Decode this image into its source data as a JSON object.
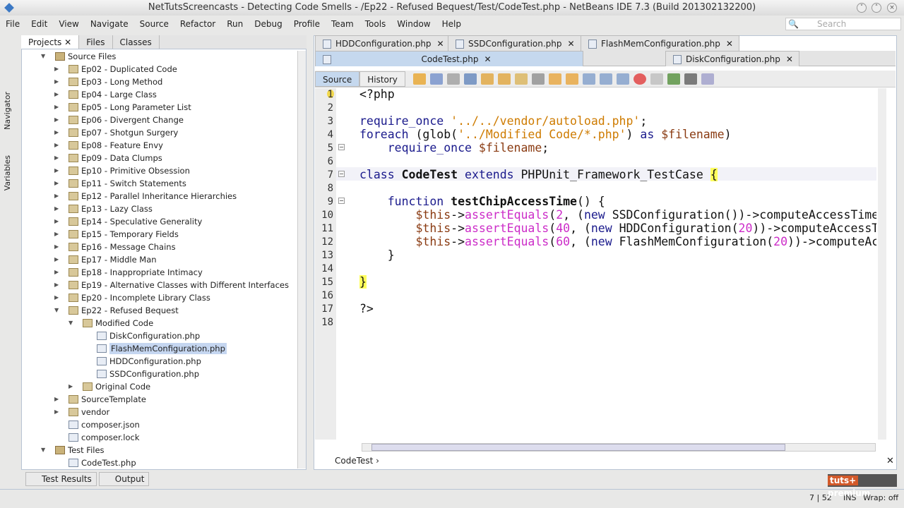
{
  "title": "NetTutsScreencasts - Detecting Code Smells - /Ep22 - Refused Bequest/Test/CodeTest.php - NetBeans IDE 7.3 (Build 201302132200)",
  "menu": [
    "File",
    "Edit",
    "View",
    "Navigate",
    "Source",
    "Refactor",
    "Run",
    "Debug",
    "Profile",
    "Team",
    "Tools",
    "Window",
    "Help"
  ],
  "search_placeholder": "Search",
  "side_strip": [
    "Navigator",
    "Variables"
  ],
  "project_tabs": [
    "Projects",
    "Files",
    "Classes"
  ],
  "tree": [
    {
      "label": "Source Files",
      "level": 1,
      "type": "pkg",
      "state": "open"
    },
    {
      "label": "Ep02 - Duplicated Code",
      "level": 2,
      "type": "folder",
      "state": "closed"
    },
    {
      "label": "Ep03 - Long Method",
      "level": 2,
      "type": "folder",
      "state": "closed"
    },
    {
      "label": "Ep04 - Large Class",
      "level": 2,
      "type": "folder",
      "state": "closed"
    },
    {
      "label": "Ep05 - Long Parameter List",
      "level": 2,
      "type": "folder",
      "state": "closed"
    },
    {
      "label": "Ep06 - Divergent Change",
      "level": 2,
      "type": "folder",
      "state": "closed"
    },
    {
      "label": "Ep07 - Shotgun Surgery",
      "level": 2,
      "type": "folder",
      "state": "closed"
    },
    {
      "label": "Ep08 - Feature Envy",
      "level": 2,
      "type": "folder",
      "state": "closed"
    },
    {
      "label": "Ep09 - Data Clumps",
      "level": 2,
      "type": "folder",
      "state": "closed"
    },
    {
      "label": "Ep10 - Primitive Obsession",
      "level": 2,
      "type": "folder",
      "state": "closed"
    },
    {
      "label": "Ep11 - Switch Statements",
      "level": 2,
      "type": "folder",
      "state": "closed"
    },
    {
      "label": "Ep12 - Parallel Inheritance Hierarchies",
      "level": 2,
      "type": "folder",
      "state": "closed"
    },
    {
      "label": "Ep13 - Lazy Class",
      "level": 2,
      "type": "folder",
      "state": "closed"
    },
    {
      "label": "Ep14 - Speculative Generality",
      "level": 2,
      "type": "folder",
      "state": "closed"
    },
    {
      "label": "Ep15 - Temporary Fields",
      "level": 2,
      "type": "folder",
      "state": "closed"
    },
    {
      "label": "Ep16 - Message Chains",
      "level": 2,
      "type": "folder",
      "state": "closed"
    },
    {
      "label": "Ep17 - Middle Man",
      "level": 2,
      "type": "folder",
      "state": "closed"
    },
    {
      "label": "Ep18 - Inappropriate Intimacy",
      "level": 2,
      "type": "folder",
      "state": "closed"
    },
    {
      "label": "Ep19 - Alternative Classes with Different Interfaces",
      "level": 2,
      "type": "folder",
      "state": "closed"
    },
    {
      "label": "Ep20 - Incomplete Library Class",
      "level": 2,
      "type": "folder",
      "state": "closed"
    },
    {
      "label": "Ep22 - Refused Bequest",
      "level": 2,
      "type": "folder",
      "state": "open"
    },
    {
      "label": "Modified Code",
      "level": 3,
      "type": "folder",
      "state": "open"
    },
    {
      "label": "DiskConfiguration.php",
      "level": 4,
      "type": "file"
    },
    {
      "label": "FlashMemConfiguration.php",
      "level": 4,
      "type": "file",
      "selected": true
    },
    {
      "label": "HDDConfiguration.php",
      "level": 4,
      "type": "file"
    },
    {
      "label": "SSDConfiguration.php",
      "level": 4,
      "type": "file"
    },
    {
      "label": "Original Code",
      "level": 3,
      "type": "folder",
      "state": "closed"
    },
    {
      "label": "SourceTemplate",
      "level": 2,
      "type": "folder",
      "state": "closed"
    },
    {
      "label": "vendor",
      "level": 2,
      "type": "folder",
      "state": "closed"
    },
    {
      "label": "composer.json",
      "level": 2,
      "type": "file"
    },
    {
      "label": "composer.lock",
      "level": 2,
      "type": "file"
    },
    {
      "label": "Test Files",
      "level": 1,
      "type": "pkg",
      "state": "open"
    },
    {
      "label": "CodeTest.php",
      "level": 2,
      "type": "file"
    }
  ],
  "editor_tabs_row1": [
    "HDDConfiguration.php",
    "SSDConfiguration.php",
    "FlashMemConfiguration.php"
  ],
  "editor_tabs_row2": [
    "CodeTest.php",
    "DiskConfiguration.php"
  ],
  "active_tab": "CodeTest.php",
  "source_label": "Source",
  "history_label": "History",
  "code": [
    [
      [
        "<?php",
        ""
      ]
    ],
    [],
    [
      [
        "require_once ",
        "kw"
      ],
      [
        "'../../vendor/autoload.php'",
        "str"
      ],
      [
        ";",
        ""
      ]
    ],
    [
      [
        "foreach ",
        "kw"
      ],
      [
        "(glob(",
        ""
      ],
      [
        "'../Modified Code/*.php'",
        "str"
      ],
      [
        ") ",
        ""
      ],
      [
        "as ",
        "kw"
      ],
      [
        "$filename",
        "var"
      ],
      [
        ")",
        ""
      ]
    ],
    [
      [
        "    require_once ",
        "kw"
      ],
      [
        "$filename",
        "var"
      ],
      [
        ";",
        ""
      ]
    ],
    [],
    [
      [
        "class ",
        "kw"
      ],
      [
        "CodeTest",
        "b"
      ],
      [
        " extends ",
        "kw"
      ],
      [
        "PHPUnit_Framework_TestCase ",
        ""
      ],
      [
        "{",
        "br"
      ]
    ],
    [],
    [
      [
        "    function ",
        "kw"
      ],
      [
        "testChipAccessTime",
        "b"
      ],
      [
        "() {",
        ""
      ]
    ],
    [
      [
        "        ",
        ""
      ],
      [
        "$this",
        "var"
      ],
      [
        "->",
        ""
      ],
      [
        "assertEquals",
        "fn"
      ],
      [
        "(",
        ""
      ],
      [
        "2",
        "num"
      ],
      [
        ", (",
        ""
      ],
      [
        "new ",
        "kw"
      ],
      [
        "SSDConfiguration())->computeAccessTime",
        ""
      ]
    ],
    [
      [
        "        ",
        ""
      ],
      [
        "$this",
        "var"
      ],
      [
        "->",
        ""
      ],
      [
        "assertEquals",
        "fn"
      ],
      [
        "(",
        ""
      ],
      [
        "40",
        "num"
      ],
      [
        ", (",
        ""
      ],
      [
        "new ",
        "kw"
      ],
      [
        "HDDConfiguration(",
        ""
      ],
      [
        "20",
        "num"
      ],
      [
        "))->computeAccessTime",
        ""
      ]
    ],
    [
      [
        "        ",
        ""
      ],
      [
        "$this",
        "var"
      ],
      [
        "->",
        ""
      ],
      [
        "assertEquals",
        "fn"
      ],
      [
        "(",
        ""
      ],
      [
        "60",
        "num"
      ],
      [
        ", (",
        ""
      ],
      [
        "new ",
        "kw"
      ],
      [
        "FlashMemConfiguration(",
        ""
      ],
      [
        "20",
        "num"
      ],
      [
        "))->computeAccessTime",
        ""
      ]
    ],
    [
      [
        "    }",
        ""
      ]
    ],
    [],
    [
      [
        "}",
        "br"
      ]
    ],
    [],
    [
      [
        "?>",
        ""
      ]
    ],
    []
  ],
  "breadcrumb": "CodeTest",
  "bottom_tabs": [
    "Test Results",
    "Output"
  ],
  "status_position": "7 | 52",
  "status_mode": "INS",
  "status_wrap": "Wrap: off",
  "watermark": "tuts+ premium"
}
